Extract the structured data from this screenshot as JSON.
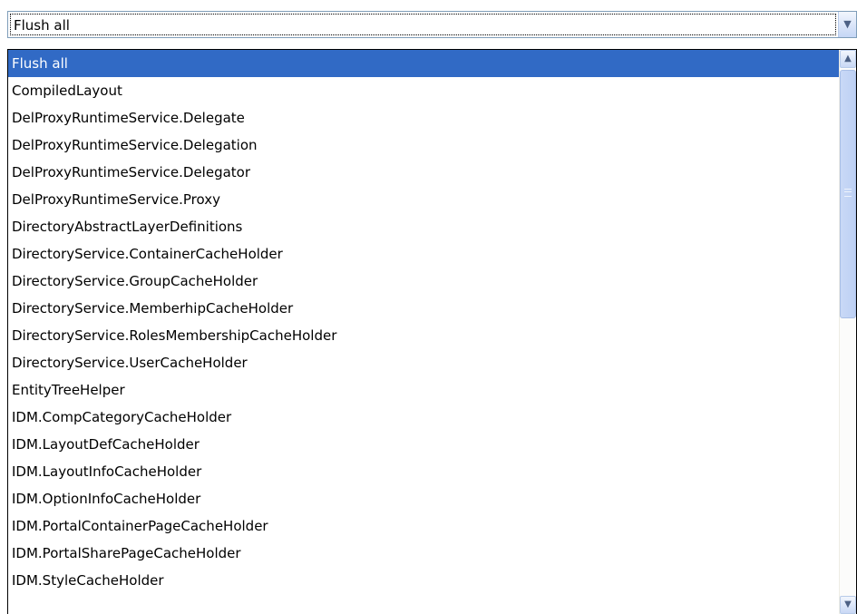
{
  "select": {
    "value": "Flush all",
    "arrow_icon": "chevron-down-icon"
  },
  "dropdown": {
    "selected_index": 0,
    "options": [
      "Flush all",
      "CompiledLayout",
      "DelProxyRuntimeService.Delegate",
      "DelProxyRuntimeService.Delegation",
      "DelProxyRuntimeService.Delegator",
      "DelProxyRuntimeService.Proxy",
      "DirectoryAbstractLayerDefinitions",
      "DirectoryService.ContainerCacheHolder",
      "DirectoryService.GroupCacheHolder",
      "DirectoryService.MemberhipCacheHolder",
      "DirectoryService.RolesMembershipCacheHolder",
      "DirectoryService.UserCacheHolder",
      "EntityTreeHelper",
      "IDM.CompCategoryCacheHolder",
      "IDM.LayoutDefCacheHolder",
      "IDM.LayoutInfoCacheHolder",
      "IDM.OptionInfoCacheHolder",
      "IDM.PortalContainerPageCacheHolder",
      "IDM.PortalSharePageCacheHolder",
      "IDM.StyleCacheHolder"
    ]
  },
  "colors": {
    "selection_bg": "#316ac5",
    "selection_fg": "#ffffff",
    "border": "#7f9db9"
  },
  "scrollbar": {
    "up_icon": "scroll-up-arrow-icon",
    "down_icon": "scroll-down-arrow-icon",
    "position_fraction": 0.0
  }
}
